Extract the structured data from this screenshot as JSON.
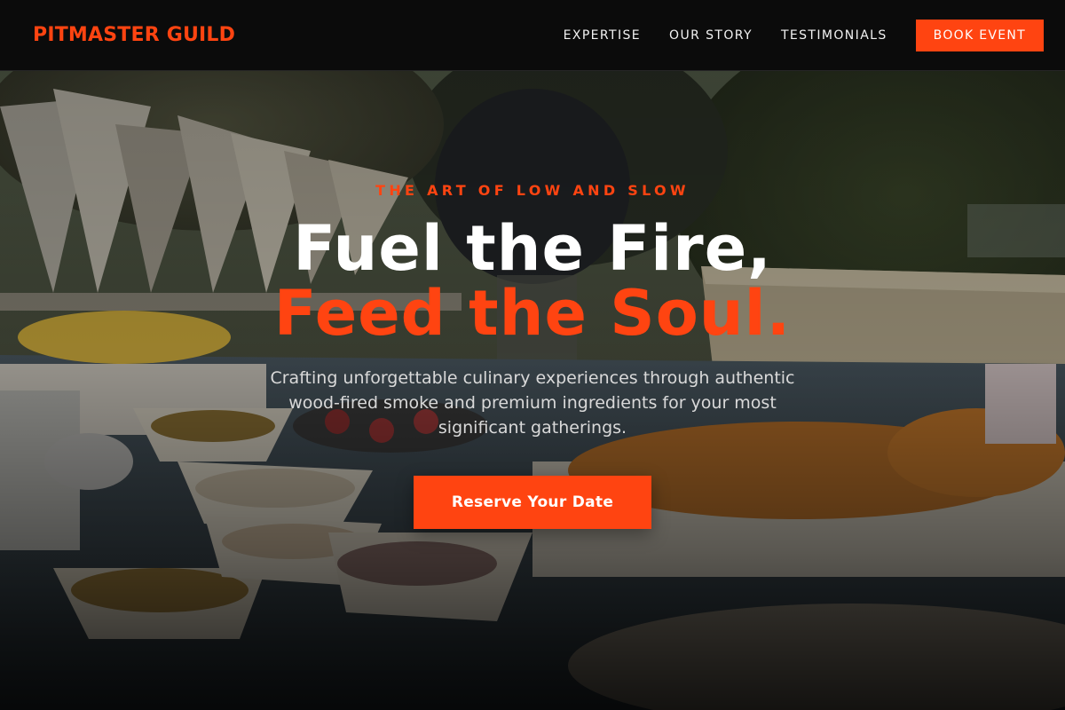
{
  "header": {
    "brand": "PITMASTER GUILD",
    "nav": [
      {
        "label": "EXPERTISE"
      },
      {
        "label": "OUR STORY"
      },
      {
        "label": "TESTIMONIALS"
      }
    ],
    "cta_label": "BOOK EVENT"
  },
  "hero": {
    "eyebrow": "THE ART OF LOW AND SLOW",
    "headline_line1": "Fuel the Fire,",
    "headline_line2": "Feed the Soul.",
    "description": "Crafting unforgettable culinary experiences through authentic wood-fired smoke and premium ingredients for your most significant gatherings.",
    "cta_label": "Reserve Your Date"
  },
  "colors": {
    "accent": "#ff4411",
    "header_bg": "#0b0b0b",
    "text_light": "#ffffff"
  }
}
